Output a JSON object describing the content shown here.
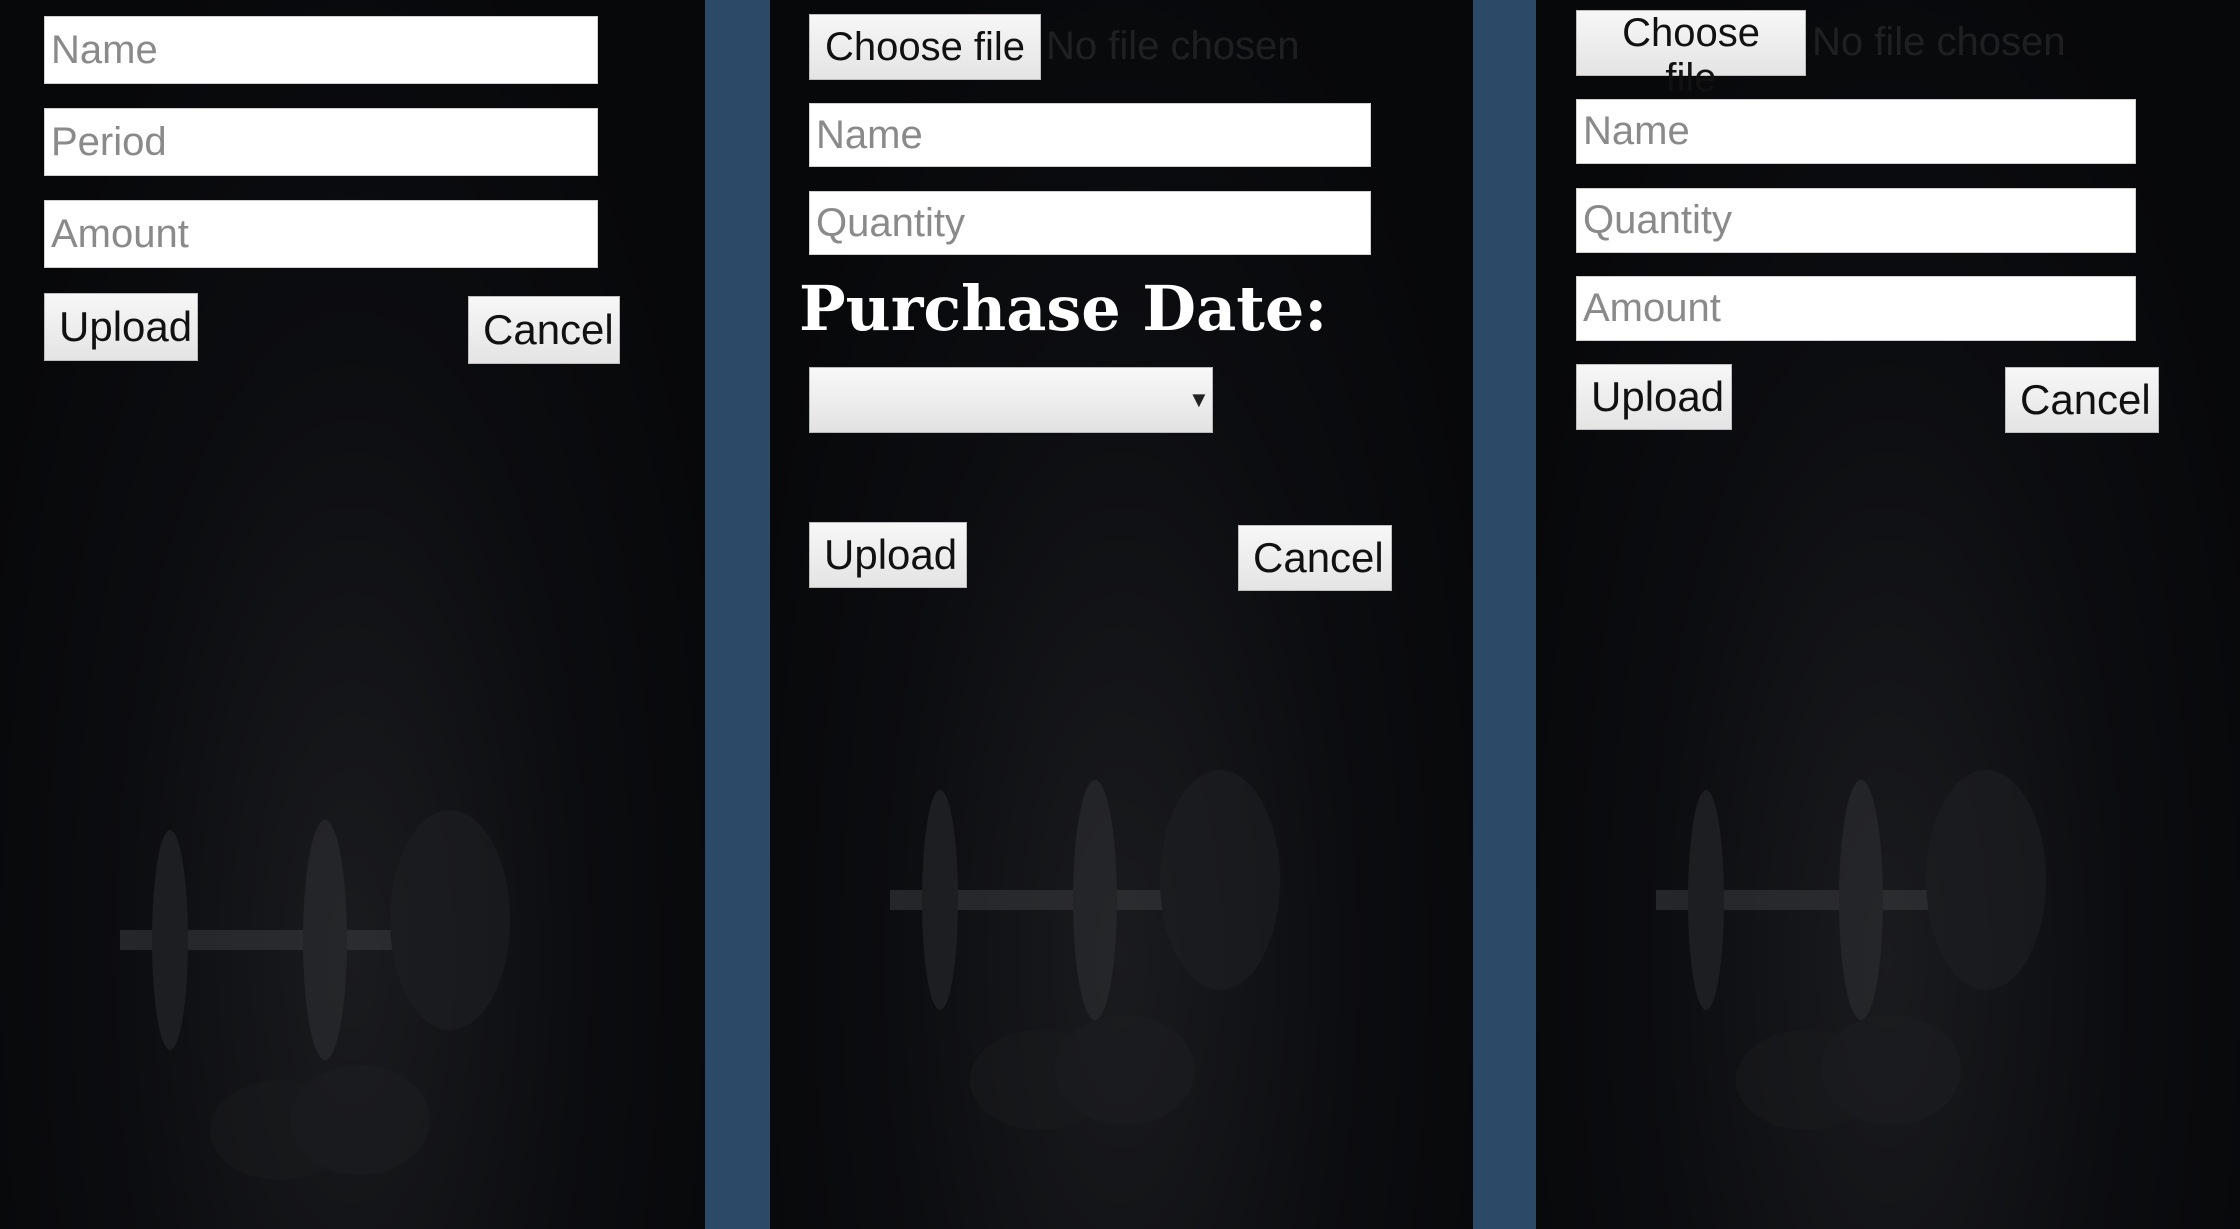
{
  "panel1": {
    "name_placeholder": "Name",
    "period_placeholder": "Period",
    "amount_placeholder": "Amount",
    "upload_label": "Upload",
    "cancel_label": "Cancel"
  },
  "panel2": {
    "choose_file_label": "Choose file",
    "no_file_text": "No file chosen",
    "name_placeholder": "Name",
    "quantity_placeholder": "Quantity",
    "purchase_date_heading": "Purchase Date:",
    "date_select_value": "",
    "upload_label": "Upload",
    "cancel_label": "Cancel"
  },
  "panel3": {
    "choose_file_label": "Choose file",
    "no_file_text": "No file chosen",
    "name_placeholder": "Name",
    "quantity_placeholder": "Quantity",
    "amount_placeholder": "Amount",
    "upload_label": "Upload",
    "cancel_label": "Cancel"
  },
  "icons": {
    "background_decoration": "dumbbell-icon",
    "select_arrow": "chevron-down-icon"
  },
  "colors": {
    "divider": "#2c4a68",
    "panel_background": "#0a0b0e",
    "heading_text": "#ffffff"
  }
}
